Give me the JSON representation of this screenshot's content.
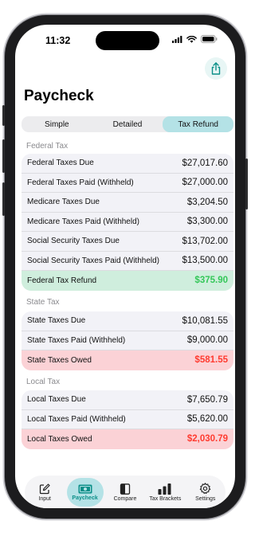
{
  "status": {
    "time": "11:32"
  },
  "page": {
    "title": "Paycheck"
  },
  "segments": [
    {
      "label": "Simple",
      "active": false
    },
    {
      "label": "Detailed",
      "active": false
    },
    {
      "label": "Tax Refund",
      "active": true
    }
  ],
  "sections": {
    "federal": {
      "label": "Federal Tax",
      "rows": [
        {
          "label": "Federal Taxes Due",
          "value": "$27,017.60"
        },
        {
          "label": "Federal Taxes Paid (Withheld)",
          "value": "$27,000.00"
        },
        {
          "label": "Medicare Taxes Due",
          "value": "$3,204.50"
        },
        {
          "label": "Medicare Taxes Paid (Withheld)",
          "value": "$3,300.00"
        },
        {
          "label": "Social Security Taxes Due",
          "value": "$13,702.00"
        },
        {
          "label": "Social Security Taxes Paid (Withheld)",
          "value": "$13,500.00"
        },
        {
          "label": "Federal Tax Refund",
          "value": "$375.90"
        }
      ]
    },
    "state": {
      "label": "State Tax",
      "rows": [
        {
          "label": "State Taxes Due",
          "value": "$10,081.55"
        },
        {
          "label": "State Taxes Paid (Withheld)",
          "value": "$9,000.00"
        },
        {
          "label": "State Taxes Owed",
          "value": "$581.55"
        }
      ]
    },
    "local": {
      "label": "Local Tax",
      "rows": [
        {
          "label": "Local Taxes Due",
          "value": "$7,650.79"
        },
        {
          "label": "Local Taxes Paid (Withheld)",
          "value": "$5,620.00"
        },
        {
          "label": "Local Taxes Owed",
          "value": "$2,030.79"
        }
      ]
    }
  },
  "tabs": [
    {
      "label": "Input",
      "icon": "edit-icon",
      "active": false
    },
    {
      "label": "Paycheck",
      "icon": "money-icon",
      "active": true
    },
    {
      "label": "Compare",
      "icon": "compare-icon",
      "active": false
    },
    {
      "label": "Tax Brackets",
      "icon": "bar-chart-icon",
      "active": false
    },
    {
      "label": "Settings",
      "icon": "gear-icon",
      "active": false
    }
  ],
  "colors": {
    "accent": "#0a8f88",
    "accent_bg": "#b4e2e6",
    "refund": "#34c759",
    "owed": "#ff3b30"
  }
}
